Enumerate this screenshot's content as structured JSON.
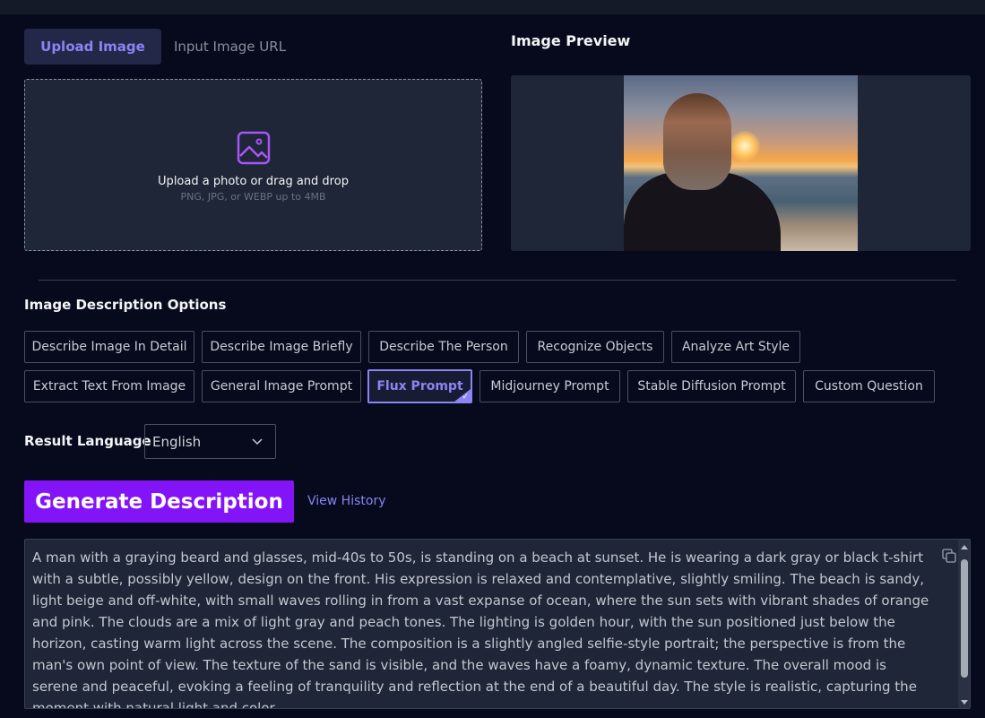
{
  "tabs": {
    "upload": "Upload Image",
    "url": "Input Image URL"
  },
  "upload": {
    "main_text": "Upload a photo or drag and drop",
    "sub_text": "PNG, JPG, or WEBP up to 4MB"
  },
  "preview": {
    "title": "Image Preview"
  },
  "options": {
    "title": "Image Description Options",
    "items": [
      "Describe Image In Detail",
      "Describe Image Briefly",
      "Describe The Person",
      "Recognize Objects",
      "Analyze Art Style",
      "Extract Text From Image",
      "General Image Prompt",
      "Flux Prompt",
      "Midjourney Prompt",
      "Stable Diffusion Prompt",
      "Custom Question"
    ],
    "selected": "Flux Prompt"
  },
  "language": {
    "label": "Result Language",
    "value": "English"
  },
  "actions": {
    "generate": "Generate Description",
    "history": "View History"
  },
  "result": {
    "text": "A man with a graying beard and glasses, mid-40s to 50s, is standing on a beach at sunset.  He is wearing a dark gray or black t-shirt with a subtle, possibly yellow, design on the front.  His expression is relaxed and contemplative, slightly smiling.  The beach is sandy, light beige and off-white, with small waves rolling in from a vast expanse of ocean, where the sun sets with vibrant shades of orange and pink.  The clouds are a mix of light gray and peach tones.  The lighting is golden hour, with the sun positioned just below the horizon, casting warm light across the scene.  The composition is a slightly angled selfie-style portrait; the perspective is from the man's own point of view.  The texture of the sand is visible, and the waves have a foamy, dynamic texture.  The overall mood is serene and peaceful, evoking a feeling of tranquility and reflection at the end of a beautiful day.  The style is realistic, capturing the moment with natural light and color."
  },
  "colors": {
    "accent": "#8b84f3",
    "button": "#8414f8",
    "background": "#060a1c",
    "panel": "#1e2637"
  }
}
